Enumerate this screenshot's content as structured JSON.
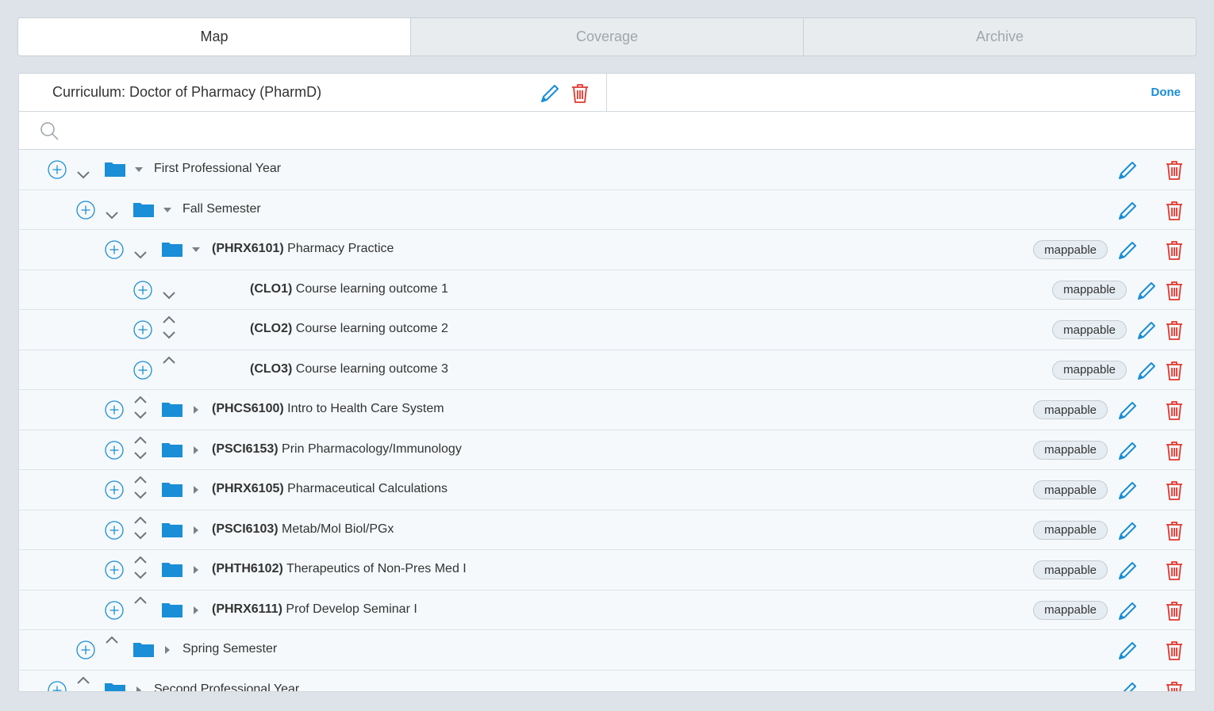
{
  "tabs": [
    {
      "label": "Map",
      "active": true
    },
    {
      "label": "Coverage",
      "active": false
    },
    {
      "label": "Archive",
      "active": false
    }
  ],
  "header": {
    "title": "Curriculum: Doctor of Pharmacy (PharmD)",
    "done_label": "Done"
  },
  "search": {
    "placeholder": "",
    "value": ""
  },
  "colors": {
    "accent": "#1a8ed6",
    "danger": "#e2372f",
    "folder": "#1a8ed6"
  },
  "tree": [
    {
      "level": 0,
      "code": "",
      "name": "First Professional Year",
      "folder": true,
      "expanded": true,
      "mappable": false,
      "up": false,
      "down": true
    },
    {
      "level": 1,
      "code": "",
      "name": "Fall Semester",
      "folder": true,
      "expanded": true,
      "mappable": false,
      "up": false,
      "down": true
    },
    {
      "level": 2,
      "code": "(PHRX6101)",
      "name": "Pharmacy Practice",
      "folder": true,
      "expanded": true,
      "mappable": true,
      "up": false,
      "down": true
    },
    {
      "level": 3,
      "code": "(CLO1)",
      "name": "Course learning outcome 1",
      "folder": false,
      "expanded": false,
      "mappable": true,
      "up": false,
      "down": true
    },
    {
      "level": 3,
      "code": "(CLO2)",
      "name": "Course learning outcome 2",
      "folder": false,
      "expanded": false,
      "mappable": true,
      "up": true,
      "down": true
    },
    {
      "level": 3,
      "code": "(CLO3)",
      "name": "Course learning outcome 3",
      "folder": false,
      "expanded": false,
      "mappable": true,
      "up": true,
      "down": false
    },
    {
      "level": 2,
      "code": "(PHCS6100)",
      "name": "Intro to Health Care System",
      "folder": true,
      "expanded": false,
      "mappable": true,
      "up": true,
      "down": true
    },
    {
      "level": 2,
      "code": "(PSCI6153)",
      "name": "Prin Pharmacology/Immunology",
      "folder": true,
      "expanded": false,
      "mappable": true,
      "up": true,
      "down": true
    },
    {
      "level": 2,
      "code": "(PHRX6105)",
      "name": "Pharmaceutical Calculations",
      "folder": true,
      "expanded": false,
      "mappable": true,
      "up": true,
      "down": true
    },
    {
      "level": 2,
      "code": "(PSCI6103)",
      "name": "Metab/Mol Biol/PGx",
      "folder": true,
      "expanded": false,
      "mappable": true,
      "up": true,
      "down": true
    },
    {
      "level": 2,
      "code": "(PHTH6102)",
      "name": "Therapeutics of Non-Pres Med I",
      "folder": true,
      "expanded": false,
      "mappable": true,
      "up": true,
      "down": true
    },
    {
      "level": 2,
      "code": "(PHRX6111)",
      "name": "Prof Develop Seminar I",
      "folder": true,
      "expanded": false,
      "mappable": true,
      "up": true,
      "down": false
    },
    {
      "level": 1,
      "code": "",
      "name": "Spring Semester",
      "folder": true,
      "expanded": false,
      "mappable": false,
      "up": true,
      "down": false
    },
    {
      "level": 0,
      "code": "",
      "name": "Second Professional Year",
      "folder": true,
      "expanded": false,
      "mappable": false,
      "up": true,
      "down": true
    }
  ],
  "badge_label": "mappable"
}
